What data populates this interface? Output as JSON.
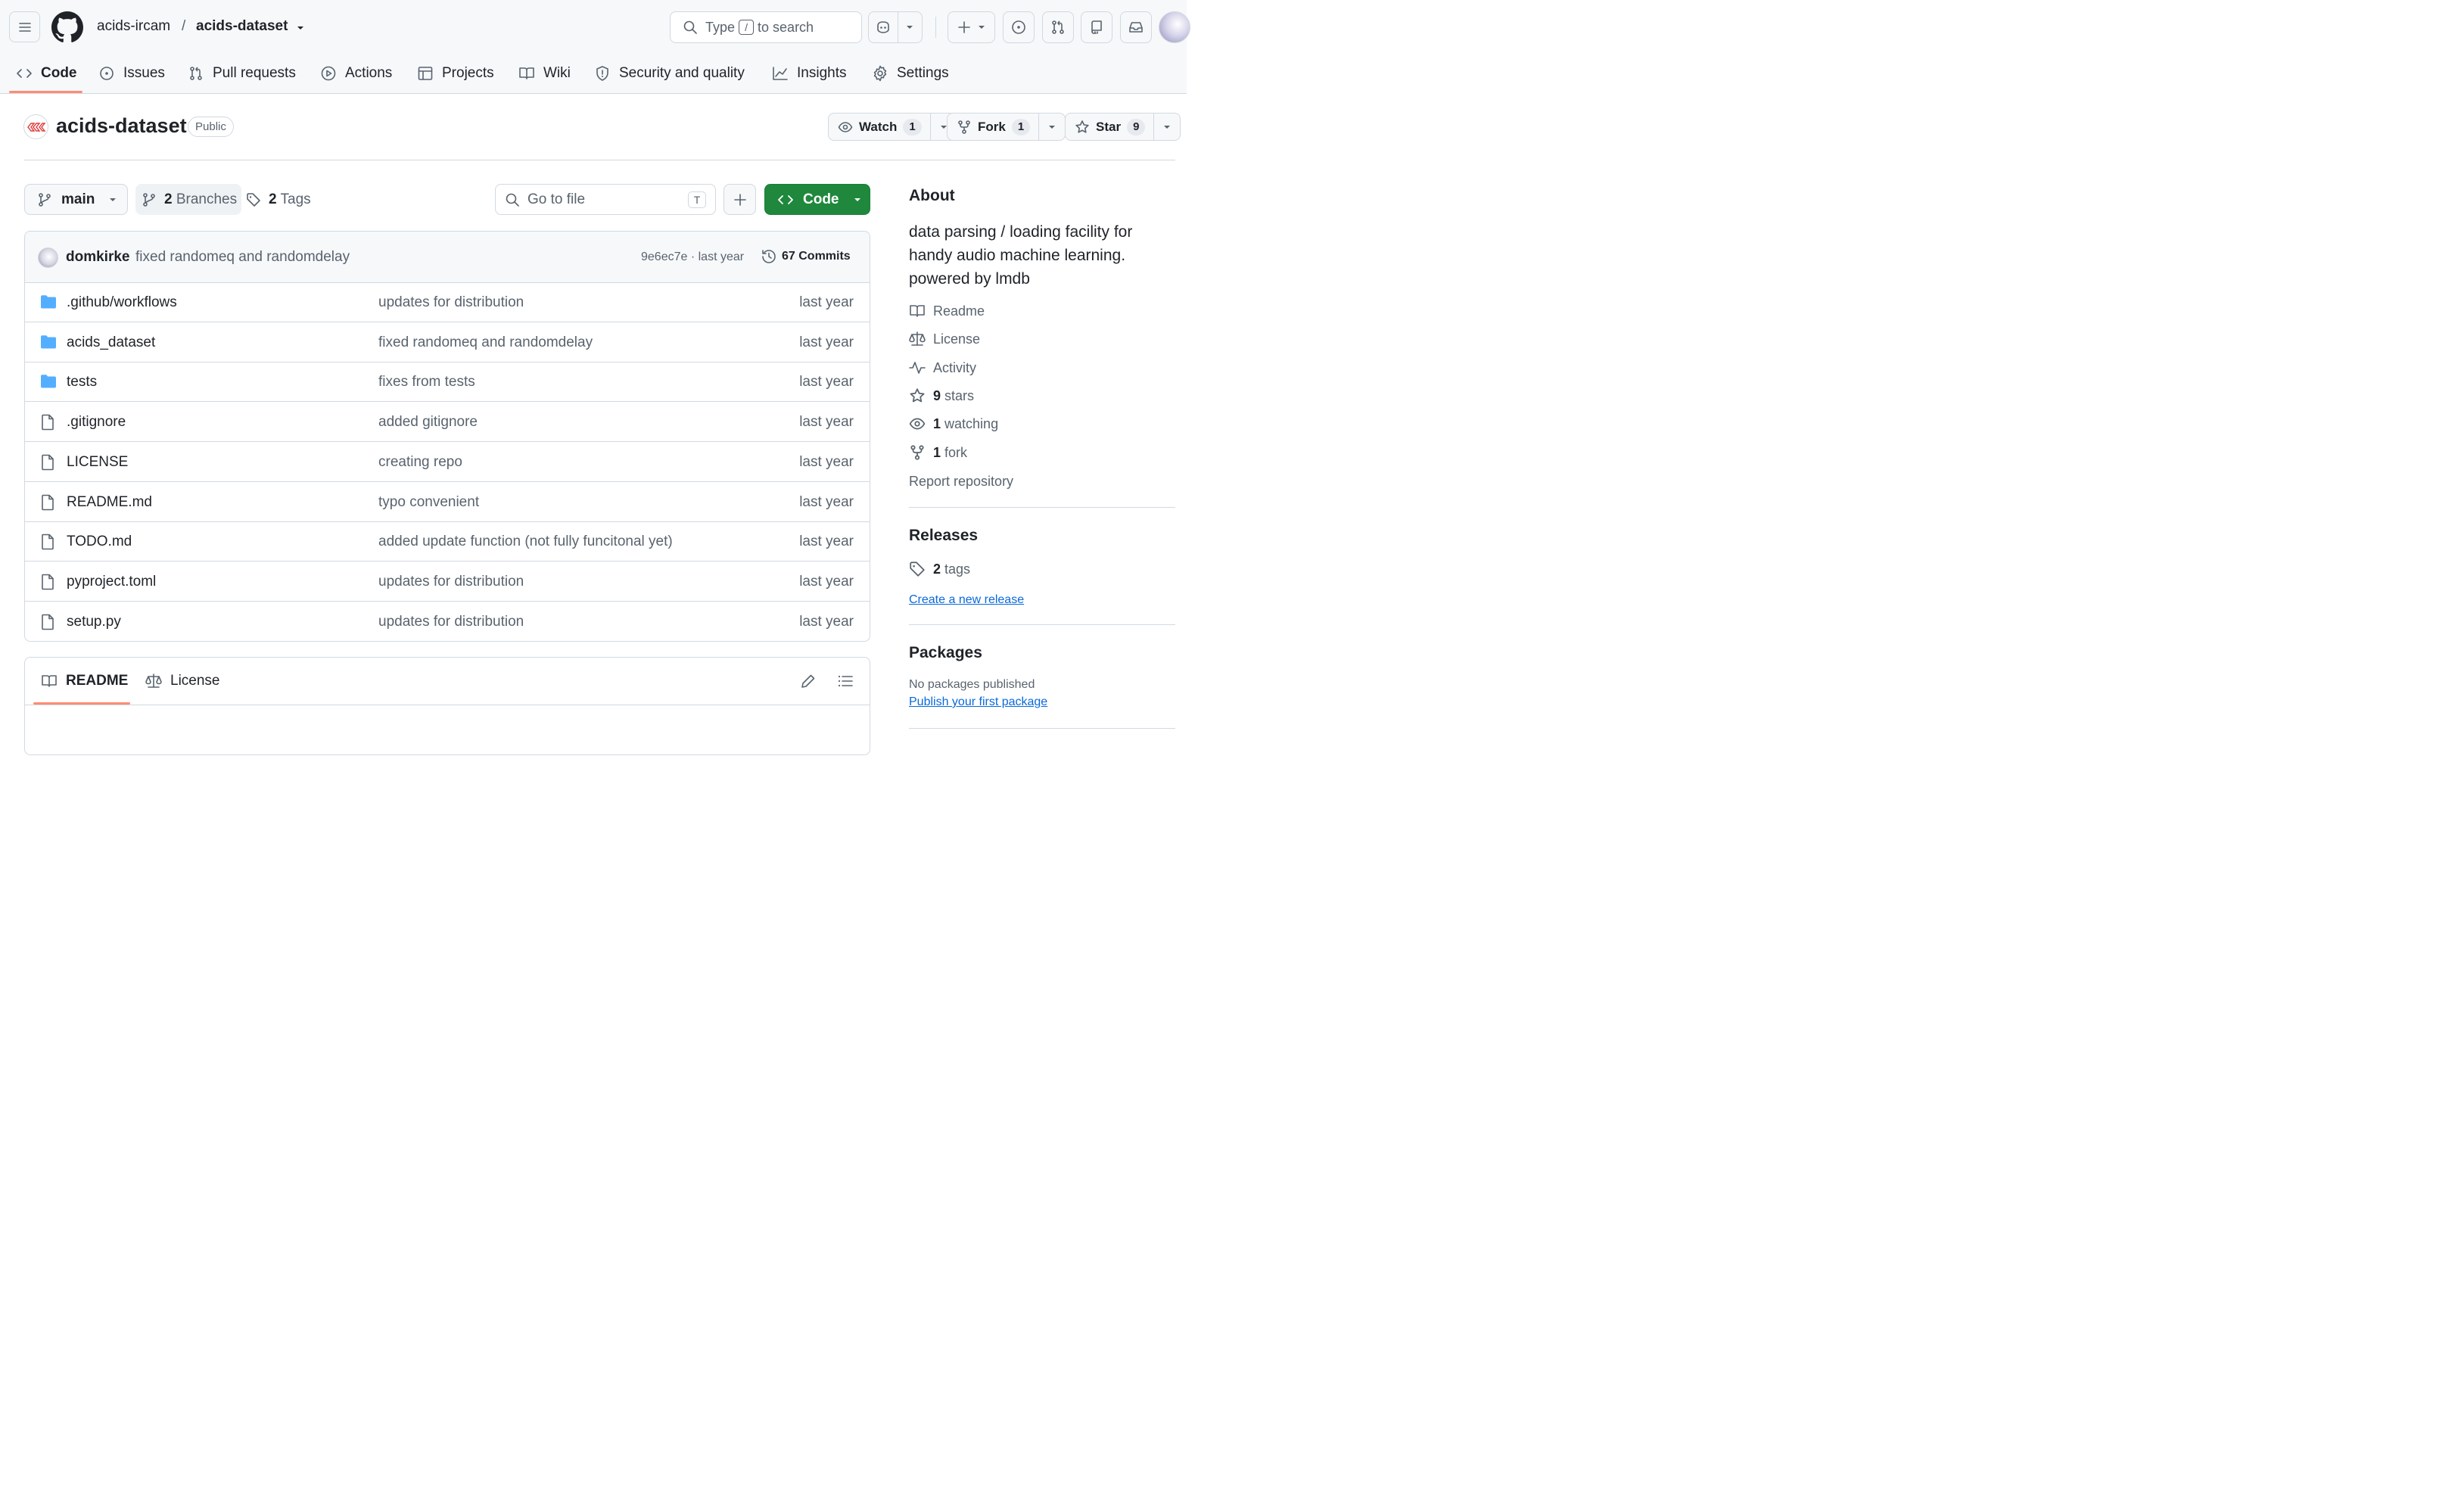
{
  "header": {
    "owner": "acids-ircam",
    "separator": "/",
    "repo": "acids-dataset",
    "search": {
      "prefix": "Type",
      "key": "/",
      "suffix": "to search"
    }
  },
  "nav": {
    "tabs": [
      {
        "label": "Code",
        "icon": "code-icon",
        "active": true
      },
      {
        "label": "Issues",
        "icon": "issue-icon"
      },
      {
        "label": "Pull requests",
        "icon": "pull-request-icon"
      },
      {
        "label": "Actions",
        "icon": "play-icon"
      },
      {
        "label": "Projects",
        "icon": "table-icon"
      },
      {
        "label": "Wiki",
        "icon": "book-icon"
      },
      {
        "label": "Security and quality",
        "icon": "shield-icon"
      },
      {
        "label": "Insights",
        "icon": "graph-icon"
      },
      {
        "label": "Settings",
        "icon": "gear-icon"
      }
    ]
  },
  "repo": {
    "title": "acids-dataset",
    "visibility": "Public",
    "watch": {
      "label": "Watch",
      "count": "1"
    },
    "fork": {
      "label": "Fork",
      "count": "1"
    },
    "star": {
      "label": "Star",
      "count": "9"
    }
  },
  "toolbar": {
    "branch": "main",
    "branches_count": "2",
    "branches_label": "Branches",
    "tags_count": "2",
    "tags_label": "Tags",
    "goto_placeholder": "Go to file",
    "goto_key": "T",
    "code_label": "Code"
  },
  "commit": {
    "author": "domkirke",
    "message": "fixed randomeq and randomdelay",
    "meta": "9e6ec7e · last year",
    "commits_label": "67 Commits"
  },
  "files": [
    {
      "name": ".github/workflows",
      "type": "folder",
      "message": "updates for distribution",
      "date": "last year"
    },
    {
      "name": "acids_dataset",
      "type": "folder",
      "message": "fixed randomeq and randomdelay",
      "date": "last year"
    },
    {
      "name": "tests",
      "type": "folder",
      "message": "fixes from tests",
      "date": "last year"
    },
    {
      "name": ".gitignore",
      "type": "file",
      "message": "added gitignore",
      "date": "last year"
    },
    {
      "name": "LICENSE",
      "type": "file",
      "message": "creating repo",
      "date": "last year"
    },
    {
      "name": "README.md",
      "type": "file",
      "message": "typo convenient",
      "date": "last year"
    },
    {
      "name": "TODO.md",
      "type": "file",
      "message": "added update function (not fully funcitonal yet)",
      "date": "last year"
    },
    {
      "name": "pyproject.toml",
      "type": "file",
      "message": "updates for distribution",
      "date": "last year"
    },
    {
      "name": "setup.py",
      "type": "file",
      "message": "updates for distribution",
      "date": "last year"
    }
  ],
  "readme": {
    "tabs": [
      "README",
      "License"
    ]
  },
  "sidebar": {
    "about_title": "About",
    "about_text": "data parsing / loading facility for handy audio machine learning. powered by lmdb",
    "items": [
      {
        "icon": "book-icon",
        "count": "",
        "label": "Readme"
      },
      {
        "icon": "law-icon",
        "count": "",
        "label": "License"
      },
      {
        "icon": "pulse-icon",
        "count": "",
        "label": "Activity"
      },
      {
        "icon": "star-icon",
        "count": "9",
        "label": "stars"
      },
      {
        "icon": "eye-icon",
        "count": "1",
        "label": "watching"
      },
      {
        "icon": "fork-icon",
        "count": "1",
        "label": "fork"
      }
    ],
    "report": "Report repository",
    "releases_title": "Releases",
    "releases_tags_count": "2",
    "releases_tags_label": "tags",
    "create_release": "Create a new release",
    "packages_title": "Packages",
    "packages_note": "No packages published",
    "publish_package": "Publish your first package"
  },
  "colors": {
    "accent_green": "#1f883d",
    "link_blue": "#0969da",
    "folder_blue": "#54aeff",
    "active_tab": "#fd8c73"
  }
}
